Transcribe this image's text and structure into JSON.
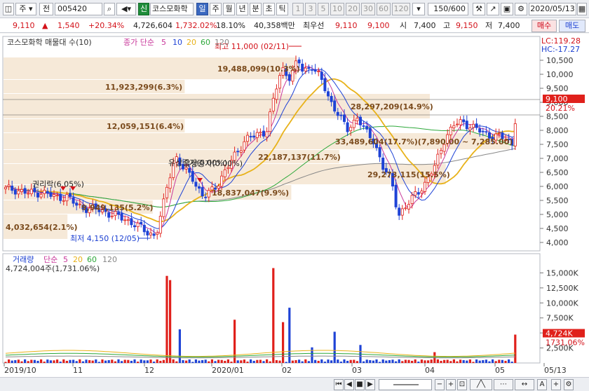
{
  "toolbar": {
    "market": "주",
    "prev_label": "전",
    "code": "005420",
    "new_badge": "신",
    "stock_name": "코스모화학",
    "periods": [
      "일",
      "주",
      "월",
      "년",
      "분",
      "초",
      "틱"
    ],
    "minutes": [
      "1",
      "3",
      "5",
      "10",
      "20",
      "30",
      "60",
      "120"
    ],
    "count": "150/600",
    "date": "2020/05/13"
  },
  "quote": {
    "price": "9,110",
    "change_arrow": "▲",
    "change": "1,540",
    "change_pct": "+20.34%",
    "volume": "4,726,604",
    "volume_pct": "1,732.02%",
    "turnover": "18.10%",
    "amount": "40,358백만",
    "best_ask_label": "최우선",
    "best_ask": "9,110",
    "best_bid": "9,100",
    "open_label": "시",
    "open": "7,400",
    "high_label": "고",
    "high": "9,150",
    "low_label": "저",
    "low": "7,400",
    "buy_label": "매수",
    "sell_label": "매도"
  },
  "price_panel": {
    "title": "코스모화학 매물대 수(10)",
    "ma_label": "종가 단순",
    "ma_periods": [
      "5",
      "10",
      "20",
      "60",
      "120"
    ],
    "lc": "LC:119.28",
    "hc": "HC:-17.27",
    "max_label": "최고 11,000 (02/11)",
    "min_label": "최저 4,150 (12/05)",
    "current_price_tag": "9,100",
    "current_pct_tag": "20.21%",
    "yticks": [
      "10,500",
      "10,000",
      "9,500",
      "9,000",
      "8,500",
      "8,000",
      "7,500",
      "7,000",
      "6,500",
      "6,000",
      "5,500",
      "5,000",
      "4,500",
      "4,000"
    ],
    "volume_profile": [
      {
        "label": "19,488,099(10.3%)"
      },
      {
        "label": "11,923,299(6.3%)"
      },
      {
        "label": "28,297,209(14.9%)"
      },
      {
        "label": "12,059,151(6.4%)"
      },
      {
        "label": "33,489,604(17.7%)(7,890.00 ~ 7,285.00)"
      },
      {
        "label": "22,187,137(11.7%)"
      },
      {
        "label": "29,273,115(15.5%)"
      },
      {
        "label": "18,837,047(9.9%)"
      },
      {
        "label": "9,949,135(5.2%)"
      },
      {
        "label": "4,032,654(2.1%)"
      }
    ],
    "event_labels": [
      "권리락(6.05%)",
      "유상증자(0.00%)",
      "유상증자(0.00%)"
    ]
  },
  "volume_panel": {
    "title": "거래량",
    "ma_label": "단순",
    "ma_periods": [
      "5",
      "20",
      "60",
      "120"
    ],
    "value_label": "4,724,004주(1,731.06%)",
    "yticks": [
      "15,000K",
      "12,500K",
      "10,000K",
      "7,500K",
      "5,000K",
      "2,500K"
    ],
    "tag_value": "4,724K",
    "tag_pct": "1731.06%"
  },
  "x_axis": [
    "2019/10",
    "11",
    "12",
    "2020/01",
    "02",
    "03",
    "04",
    "05",
    "05/13"
  ],
  "colors": {
    "up": "#e0201b",
    "down": "#1f43d6",
    "ma5": "#c8389b",
    "ma10": "#1f43d6",
    "ma20": "#e8b21a",
    "ma60": "#2da83a",
    "ma120": "#888888",
    "profile": "#f6e9d8"
  },
  "chart_data": {
    "type": "candlestick",
    "price_range": [
      4000,
      11000
    ],
    "volume_range_k": [
      0,
      17500
    ],
    "high": 11000,
    "low": 4150,
    "last_close": 9100
  }
}
